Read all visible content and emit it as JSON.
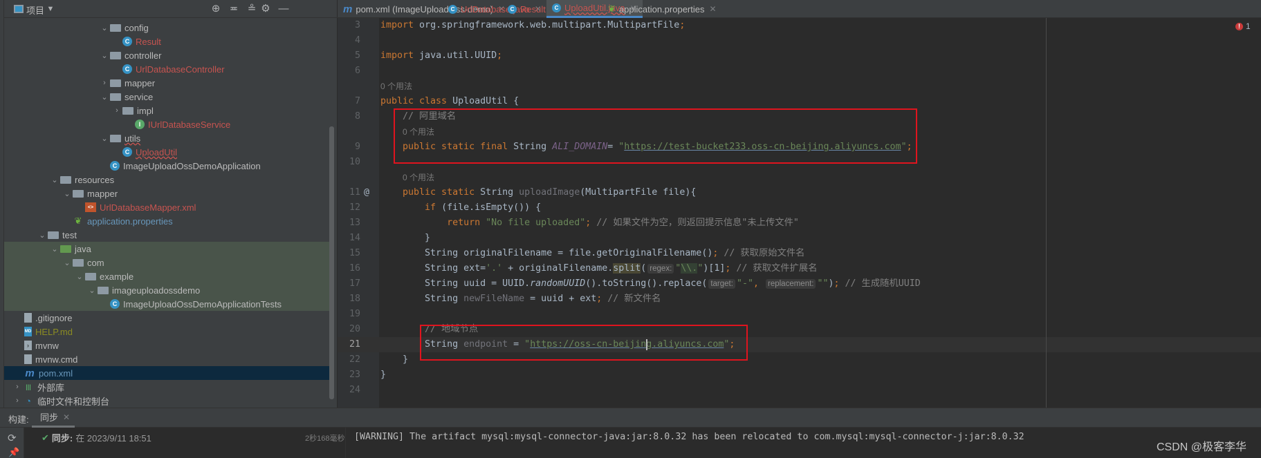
{
  "project_panel": {
    "title": "项目",
    "tree": [
      {
        "label": "config",
        "level": 5,
        "type": "package",
        "expanded": true,
        "color": "#bbbbbb"
      },
      {
        "label": "Result",
        "level": 6,
        "type": "class",
        "color": "#c75450"
      },
      {
        "label": "controller",
        "level": 5,
        "type": "package",
        "expanded": true,
        "color": "#bbbbbb"
      },
      {
        "label": "UrlDatabaseController",
        "level": 6,
        "type": "class",
        "color": "#c75450"
      },
      {
        "label": "mapper",
        "level": 5,
        "type": "package",
        "expanded": false,
        "color": "#bbbbbb"
      },
      {
        "label": "service",
        "level": 5,
        "type": "package",
        "expanded": true,
        "color": "#bbbbbb"
      },
      {
        "label": "impl",
        "level": 6,
        "type": "package",
        "expanded": false,
        "color": "#bbbbbb"
      },
      {
        "label": "IUrlDatabaseService",
        "level": 7,
        "type": "interface",
        "color": "#c75450"
      },
      {
        "label": "utils",
        "level": 5,
        "type": "package",
        "expanded": true,
        "color": "#bbbbbb",
        "squiggle": true
      },
      {
        "label": "UploadUtil",
        "level": 6,
        "type": "class",
        "color": "#c75450",
        "squiggle": true
      },
      {
        "label": "ImageUploadOssDemoApplication",
        "level": 5,
        "type": "spring-class",
        "color": "#bbbbbb",
        "leaf_no_chevron": true
      },
      {
        "label": "resources",
        "level": 1,
        "type": "resources-folder",
        "expanded": true,
        "color": "#bbbbbb"
      },
      {
        "label": "mapper",
        "level": 2,
        "type": "folder",
        "expanded": true,
        "color": "#bbbbbb"
      },
      {
        "label": "UrlDatabaseMapper.xml",
        "level": 3,
        "type": "xml",
        "color": "#c75450"
      },
      {
        "label": "application.properties",
        "level": 2,
        "type": "properties",
        "color": "#6897bb"
      },
      {
        "label": "test",
        "level": 0,
        "type": "folder",
        "expanded": true,
        "color": "#bbbbbb"
      },
      {
        "label": "java",
        "level": 1,
        "type": "test-folder",
        "expanded": true,
        "color": "#bbbbbb",
        "test": true
      },
      {
        "label": "com",
        "level": 2,
        "type": "package",
        "expanded": true,
        "color": "#bbbbbb",
        "test": true
      },
      {
        "label": "example",
        "level": 3,
        "type": "package",
        "expanded": true,
        "color": "#bbbbbb",
        "test": true
      },
      {
        "label": "imageuploadossdemo",
        "level": 4,
        "type": "package",
        "expanded": true,
        "color": "#bbbbbb",
        "test": true
      },
      {
        "label": "ImageUploadOssDemoApplicationTests",
        "level": 5,
        "type": "test-class",
        "color": "#bbbbbb",
        "test": true
      },
      {
        "label": ".gitignore",
        "level": -1,
        "type": "file",
        "color": "#bbbbbb"
      },
      {
        "label": "HELP.md",
        "level": -1,
        "type": "md",
        "color": "#8c8c22"
      },
      {
        "label": "mvnw",
        "level": -1,
        "type": "script",
        "color": "#bbbbbb"
      },
      {
        "label": "mvnw.cmd",
        "level": -1,
        "type": "file",
        "color": "#bbbbbb"
      },
      {
        "label": "pom.xml",
        "level": -1,
        "type": "maven",
        "color": "#6897bb",
        "selected": true
      },
      {
        "label": "外部库",
        "level": -2,
        "type": "library",
        "expanded": false,
        "color": "#bbbbbb"
      },
      {
        "label": "临时文件和控制台",
        "level": -2,
        "type": "scratches",
        "expanded": false,
        "color": "#bbbbbb"
      }
    ]
  },
  "tabs": [
    {
      "label": "pom.xml (ImageUploadOss-demo)",
      "icon": "maven-icon",
      "color": "#bbbbbb"
    },
    {
      "label": "UrlDatabase.java",
      "icon": "class-icon",
      "color": "#c75450"
    },
    {
      "label": "Result.java",
      "icon": "class-icon",
      "color": "#c75450"
    },
    {
      "label": "UploadUtil.java",
      "icon": "class-icon",
      "color": "#c75450",
      "active": true
    },
    {
      "label": "application.properties",
      "icon": "spring-properties-icon",
      "color": "#bbbbbb"
    }
  ],
  "editor": {
    "inspections": {
      "errors": "1"
    },
    "lines": [
      {
        "n": "3",
        "tokens": [
          [
            "kw",
            "import"
          ],
          [
            "id",
            " org.springframework.web.multipart.MultipartFile"
          ],
          [
            "kw",
            ";"
          ]
        ]
      },
      {
        "n": "4",
        "tokens": []
      },
      {
        "n": "5",
        "tokens": [
          [
            "kw",
            "import"
          ],
          [
            "id",
            " java.util.UUID"
          ],
          [
            "kw",
            ";"
          ]
        ]
      },
      {
        "n": "6",
        "tokens": []
      },
      {
        "hint": "0 个用法",
        "indent": ""
      },
      {
        "n": "7",
        "tokens": [
          [
            "kw",
            "public class "
          ],
          [
            "id",
            "UploadUtil {"
          ]
        ]
      },
      {
        "n": "8",
        "tokens": [
          [
            "cm",
            "    // 阿里域名"
          ]
        ]
      },
      {
        "hint": "0 个用法",
        "indent": "    "
      },
      {
        "n": "9",
        "tokens": [
          [
            "kw",
            "    public static final "
          ],
          [
            "id",
            "String "
          ],
          [
            "const",
            "ALI_DOMAIN"
          ],
          [
            "id",
            "= "
          ],
          [
            "str",
            "\""
          ],
          [
            "url",
            "https://test-bucket233.oss-cn-beijing.aliyuncs.com"
          ],
          [
            "str",
            "\""
          ],
          [
            "kw",
            ";"
          ]
        ]
      },
      {
        "n": "10",
        "tokens": []
      },
      {
        "hint": "0 个用法",
        "indent": "    "
      },
      {
        "n": "11",
        "gutter": "@",
        "tokens": [
          [
            "kw",
            "    public static "
          ],
          [
            "id",
            "String "
          ],
          [
            "gray",
            "uploadImage"
          ],
          [
            "id",
            "(MultipartFile file){"
          ]
        ]
      },
      {
        "n": "12",
        "tokens": [
          [
            "kw",
            "        if "
          ],
          [
            "id",
            "(file.isEmpty()) {"
          ]
        ]
      },
      {
        "n": "13",
        "tokens": [
          [
            "kw",
            "            return "
          ],
          [
            "str",
            "\"No file uploaded\""
          ],
          [
            "kw",
            "; "
          ],
          [
            "cm",
            "// 如果文件为空，则返回提示信息\"未上传文件\""
          ]
        ]
      },
      {
        "n": "14",
        "tokens": [
          [
            "id",
            "        }"
          ]
        ]
      },
      {
        "n": "15",
        "tokens": [
          [
            "id",
            "        String originalFilename = file.getOriginalFilename()"
          ],
          [
            "kw",
            "; "
          ],
          [
            "cm",
            "// 获取原始文件名"
          ]
        ]
      },
      {
        "n": "16",
        "tokens": [
          [
            "id",
            "        String ext="
          ],
          [
            "str",
            "'.'"
          ],
          [
            "id",
            " + originalFilename."
          ],
          [
            "hl",
            "split"
          ],
          [
            "id",
            "("
          ],
          [
            "inlay",
            "regex:"
          ],
          [
            "str",
            "\""
          ],
          [
            "hl2",
            "\\\\."
          ],
          [
            "str",
            "\""
          ],
          [
            "id",
            ")["
          ],
          [
            "num",
            "1"
          ],
          [
            "id",
            "]"
          ],
          [
            "kw",
            "; "
          ],
          [
            "cm",
            "// 获取文件扩展名"
          ]
        ]
      },
      {
        "n": "17",
        "tokens": [
          [
            "id",
            "        String uuid = UUID."
          ],
          [
            "ital",
            "randomUUID"
          ],
          [
            "id",
            "().toString().replace("
          ],
          [
            "inlay",
            "target:"
          ],
          [
            "str",
            "\"-\""
          ],
          [
            "kw",
            ", "
          ],
          [
            "inlay",
            "replacement:"
          ],
          [
            "str",
            "\"\""
          ],
          [
            "id",
            ")"
          ],
          [
            "kw",
            "; "
          ],
          [
            "cm",
            "// 生成随机UUID"
          ]
        ]
      },
      {
        "n": "18",
        "tokens": [
          [
            "id",
            "        String "
          ],
          [
            "gray",
            "newFileName"
          ],
          [
            "id",
            " = uuid + ext"
          ],
          [
            "kw",
            "; "
          ],
          [
            "cm",
            "// 新文件名"
          ]
        ]
      },
      {
        "n": "19",
        "tokens": []
      },
      {
        "n": "20",
        "tokens": [
          [
            "cm",
            "        // 地域节点"
          ]
        ]
      },
      {
        "n": "21",
        "current": true,
        "tokens": [
          [
            "id",
            "        String "
          ],
          [
            "gray",
            "endpoint"
          ],
          [
            "id",
            " = "
          ],
          [
            "str",
            "\""
          ],
          [
            "url",
            "https://oss-cn-beijing.aliyuncs.com"
          ],
          [
            "str",
            "\""
          ],
          [
            "kw",
            ";"
          ]
        ]
      },
      {
        "n": "22",
        "tokens": [
          [
            "id",
            "    }"
          ]
        ]
      },
      {
        "n": "23",
        "tokens": [
          [
            "id",
            "}"
          ]
        ]
      },
      {
        "n": "24",
        "tokens": []
      }
    ]
  },
  "bottom_panel": {
    "label": "构建:",
    "tab": "同步",
    "sync_label": "同步:",
    "sync_time": "在 2023/9/11 18:51",
    "duration": "2秒168毫秒",
    "console": "[WARNING] The artifact mysql:mysql-connector-java:jar:8.0.32 has been relocated to com.mysql:mysql-connector-j:jar:8.0.32"
  },
  "watermark": "CSDN @极客李华",
  "colors": {
    "accent": "#4a88c7",
    "annotation_box": "#e0141e",
    "error": "#c93b3b",
    "warning": "#e0a80c"
  }
}
